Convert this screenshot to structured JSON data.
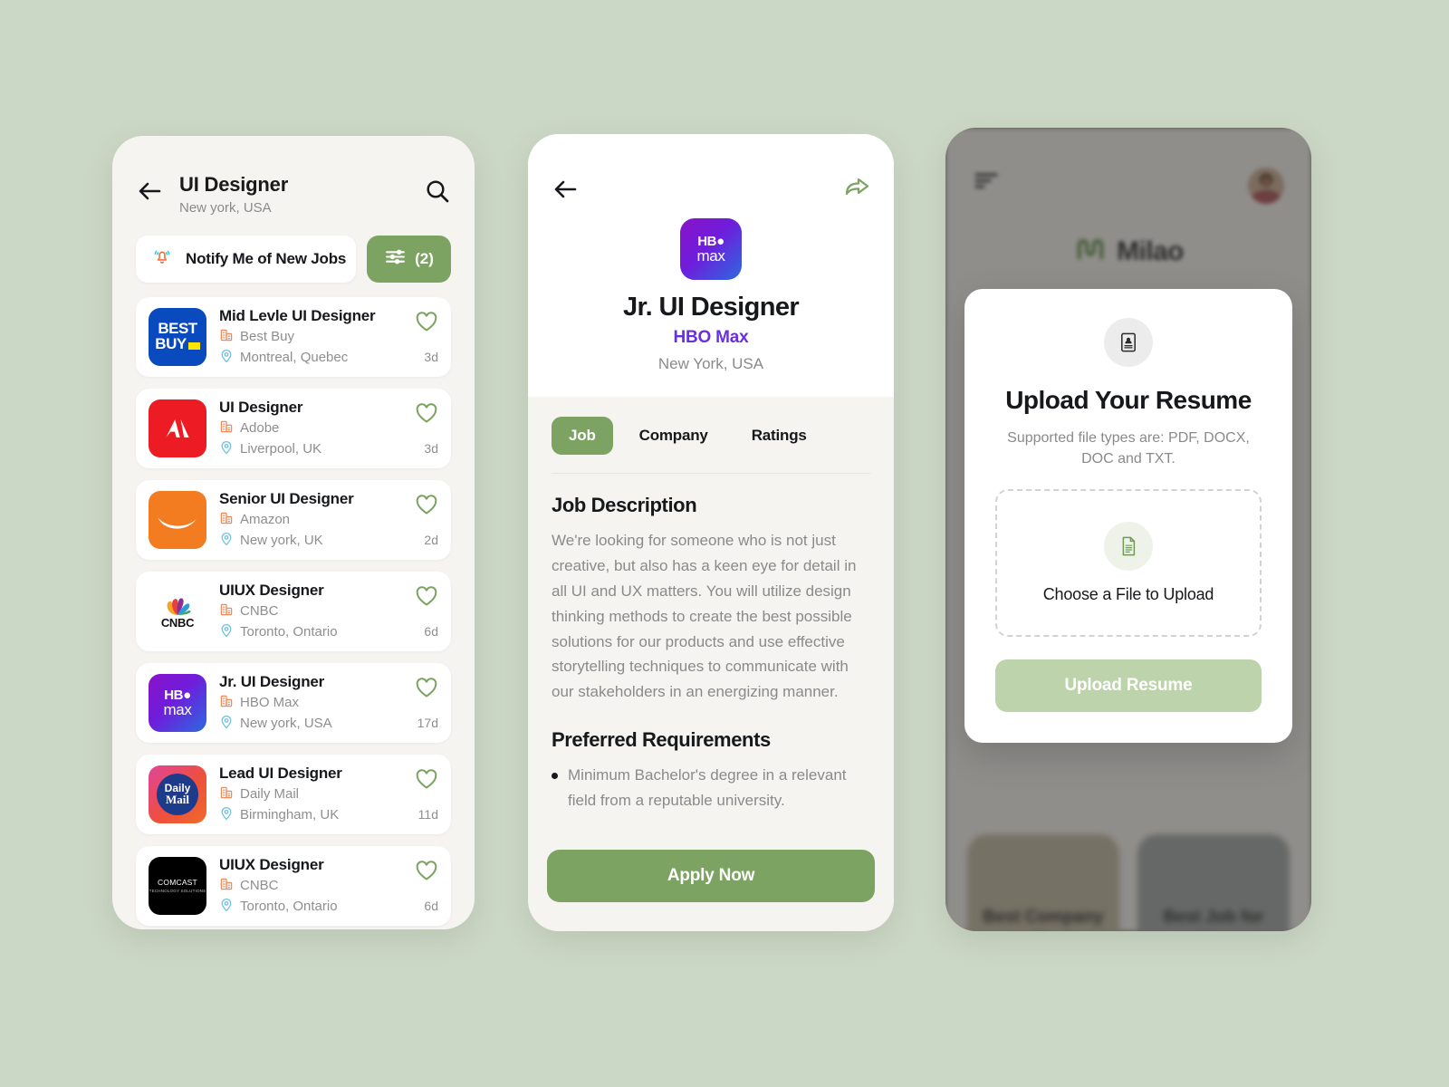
{
  "theme": {
    "page_background": "#ccd8c6",
    "accent_green": "#7ca362",
    "accent_green_muted": "#bcd3ab",
    "surface": "#f5f4f1",
    "card": "#ffffff",
    "text_primary": "#16181c",
    "text_muted": "#8a8a8a",
    "hbo_purple": "#6a2fe0"
  },
  "screen_jobs": {
    "back_icon": "arrow-left-icon",
    "title": "UI Designer",
    "subtitle": "New york, USA",
    "search_icon": "search-icon",
    "notify": {
      "icon": "bell-ringing-icon",
      "label": "Notify Me of New Jobs"
    },
    "filter": {
      "icon": "sliders-icon",
      "count_label": "(2)"
    },
    "jobs": [
      {
        "title": "Mid Levle UI Designer",
        "company": "Best Buy",
        "location": "Montreal, Quebec",
        "age": "3d",
        "logo": "bestbuy",
        "saved": false
      },
      {
        "title": "UI Designer",
        "company": "Adobe",
        "location": "Liverpool, UK",
        "age": "3d",
        "logo": "adobe",
        "saved": false
      },
      {
        "title": "Senior UI Designer",
        "company": "Amazon",
        "location": "New york, UK",
        "age": "2d",
        "logo": "amazon",
        "saved": false
      },
      {
        "title": "UIUX Designer",
        "company": "CNBC",
        "location": "Toronto, Ontario",
        "age": "6d",
        "logo": "cnbc",
        "saved": false
      },
      {
        "title": "Jr. UI Designer",
        "company": "HBO Max",
        "location": "New york, USA",
        "age": "17d",
        "logo": "hbomax",
        "saved": false
      },
      {
        "title": "Lead UI Designer",
        "company": "Daily Mail",
        "location": "Birmingham, UK",
        "age": "11d",
        "logo": "dailymail",
        "saved": false
      },
      {
        "title": "UIUX Designer",
        "company": "CNBC",
        "location": "Toronto, Ontario",
        "age": "6d",
        "logo": "comcast",
        "saved": false
      }
    ],
    "company_icon": "building-icon",
    "location_icon": "map-pin-icon",
    "save_icon": "heart-icon"
  },
  "screen_detail": {
    "back_icon": "arrow-left-icon",
    "share_icon": "share-icon",
    "logo": "hbomax",
    "job_title": "Jr. UI Designer",
    "company": "HBO Max",
    "location": "New York, USA",
    "tabs": [
      {
        "label": "Job",
        "active": true
      },
      {
        "label": "Company",
        "active": false
      },
      {
        "label": "Ratings",
        "active": false
      }
    ],
    "description_heading": "Job Description",
    "description": "We're looking for someone who is not just creative, but also has a keen eye for detail in all UI and UX matters. You will utilize design thinking methods to create the best possible solutions for our products and use effective storytelling techniques to communicate with our stakeholders in an energizing manner.",
    "requirements_heading": "Preferred Requirements",
    "requirements": [
      "Minimum Bachelor's degree in a relevant field from a reputable university."
    ],
    "apply_label": "Apply Now"
  },
  "screen_upload": {
    "menu_icon": "hamburger-icon",
    "avatar_icon": "avatar",
    "brand_name": "Milao",
    "brand_icon": "milao-logo-icon",
    "promo_cards": [
      "Best Company to Work",
      "Best Job for You"
    ],
    "modal": {
      "badge_icon": "id-card-icon",
      "title": "Upload Your Resume",
      "subtitle": "Supported file types are: PDF, DOCX, DOC and TXT.",
      "dropzone_icon": "document-icon",
      "dropzone_label": "Choose a File to Upload",
      "submit_label": "Upload Resume"
    }
  }
}
